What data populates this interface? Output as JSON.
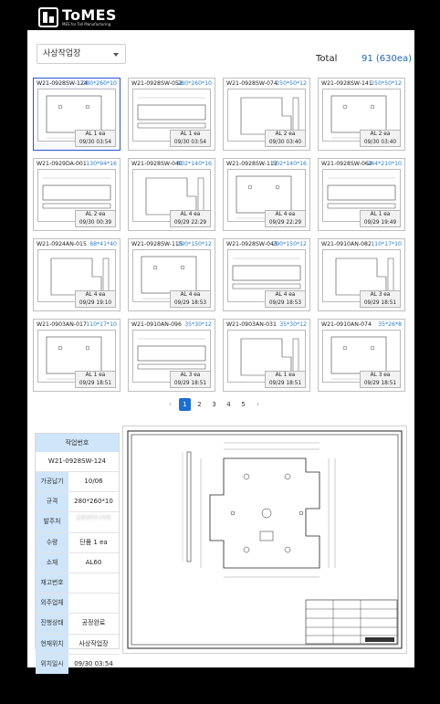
{
  "logo": {
    "title": "ToMES",
    "subtitle": "MES for Tall Manufacturing"
  },
  "filter": {
    "selected": "사상작업장"
  },
  "total": {
    "label": "Total",
    "value": "91 (630ea)"
  },
  "cards": [
    {
      "code": "W21-0928SW-124",
      "size": "280*260*10",
      "qty": "AL 1 ea",
      "date": "09/30 03:54",
      "selected": true
    },
    {
      "code": "W21-0928SW-052",
      "size": "280*260*10",
      "qty": "AL 1 ea",
      "date": "09/30 03:54"
    },
    {
      "code": "W21-0928SW-074",
      "size": "250*50*12",
      "qty": "AL 2 ea",
      "date": "09/30 03:40"
    },
    {
      "code": "W21-0928SW-141",
      "size": "250*50*12",
      "qty": "AL 2 ea",
      "date": "09/30 03:40"
    },
    {
      "code": "W21-0929DA-001",
      "size": "130*94*16",
      "qty": "AL 2 ea",
      "date": "09/30 00:39"
    },
    {
      "code": "W21-0928SW-040",
      "size": "502*140*16",
      "qty": "AL 4 ea",
      "date": "09/29 22:29"
    },
    {
      "code": "W21-0928SW-113",
      "size": "502*140*16",
      "qty": "AL 4 ea",
      "date": "09/29 22:29"
    },
    {
      "code": "W21-0928SW-062",
      "size": "244*210*10",
      "qty": "AL 1 ea",
      "date": "09/29 19:49"
    },
    {
      "code": "W21-0924AN-015",
      "size": "68*41*40",
      "qty": "AL 4 ea",
      "date": "09/29 19:10"
    },
    {
      "code": "W21-0928SW-115",
      "size": "290*150*12",
      "qty": "AL 4 ea",
      "date": "09/29 18:53"
    },
    {
      "code": "W21-0928SW-043",
      "size": "290*150*12",
      "qty": "AL 4 ea",
      "date": "09/29 18:53"
    },
    {
      "code": "W21-0910AN-082",
      "size": "110*17*10",
      "qty": "AL 3 ea",
      "date": "09/29 18:51"
    },
    {
      "code": "W21-0903AN-017",
      "size": "110*17*10",
      "qty": "AL 1 ea",
      "date": "09/29 18:51"
    },
    {
      "code": "W21-0910AN-096",
      "size": "35*30*12",
      "qty": "AL 3 ea",
      "date": "09/29 18:51"
    },
    {
      "code": "W21-0903AN-031",
      "size": "35*30*12",
      "qty": "AL 1 ea",
      "date": "09/29 18:51"
    },
    {
      "code": "W21-0910AN-074",
      "size": "35*26*8",
      "qty": "AL 3 ea",
      "date": "09/29 18:51"
    }
  ],
  "pagination": {
    "prev": "‹",
    "next": "›",
    "pages": [
      "1",
      "2",
      "3",
      "4",
      "5"
    ],
    "current": "1"
  },
  "detail": {
    "header": "작업번호",
    "code": "W21-0928SW-124",
    "rows": [
      {
        "label": "가공납기",
        "value": "10/06"
      },
      {
        "label": "규격",
        "value": "280*260*10"
      },
      {
        "label": "발주처",
        "value": "삼원엔지니어링",
        "blur": true
      },
      {
        "label": "수량",
        "value": "단품 1 ea"
      },
      {
        "label": "소재",
        "value": "AL60"
      },
      {
        "label": "재고번호",
        "value": ""
      },
      {
        "label": "외주업체",
        "value": ""
      },
      {
        "label": "진행상태",
        "value": "공정완료"
      },
      {
        "label": "현재위치",
        "value": "사상작업장"
      },
      {
        "label": "위치일시",
        "value": "09/30 03:54"
      }
    ]
  },
  "colors": {
    "accent": "#1a6fd3",
    "size_text": "#2a7ed8",
    "label_bg": "#cfe5fa",
    "selected_border": "#2c55d4"
  }
}
